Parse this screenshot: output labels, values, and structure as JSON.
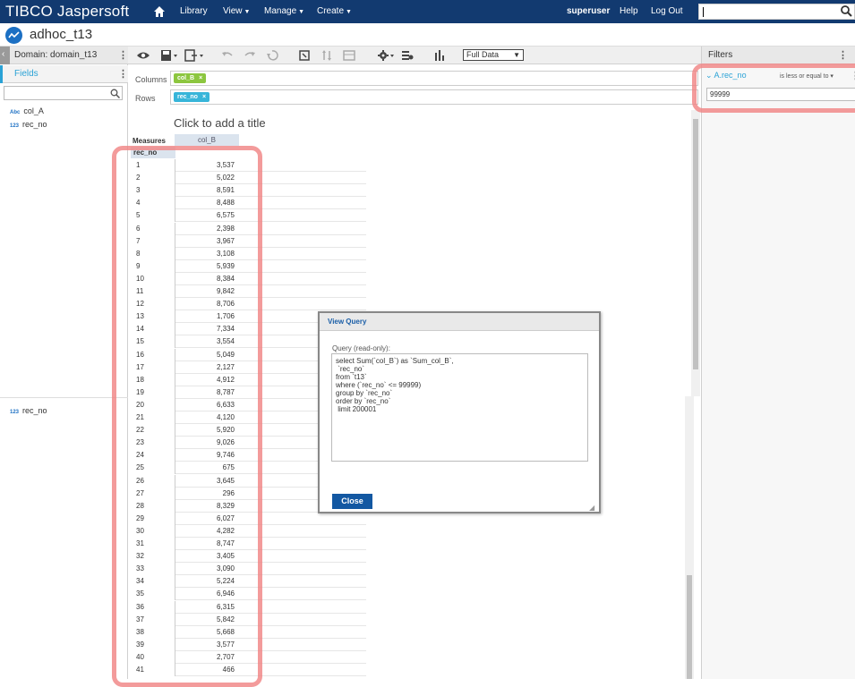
{
  "nav": {
    "logo": "TIBCO Jaspersoft",
    "library": "Library",
    "view": "View",
    "manage": "Manage",
    "create": "Create",
    "user": "superuser",
    "help": "Help",
    "logout": "Log Out"
  },
  "title": "adhoc_t13",
  "left_panel": {
    "domain_label": "Domain: domain_t13",
    "fields_tab": "Fields",
    "fields": [
      {
        "type": "Abc",
        "name": "col_A"
      },
      {
        "type": "123",
        "name": "rec_no"
      }
    ],
    "fields_lower": [
      {
        "type": "123",
        "name": "rec_no"
      }
    ]
  },
  "toolbar": {
    "data_size": "Full Data"
  },
  "axes": {
    "columns_label": "Columns",
    "rows_label": "Rows",
    "column_pill": "col_B",
    "row_pill": "rec_no"
  },
  "report": {
    "title_placeholder": "Click to add a title",
    "measures_label": "Measures",
    "measure_header": "col_B",
    "row_header": "rec_no",
    "rows": [
      [
        "1",
        "3,537"
      ],
      [
        "2",
        "5,022"
      ],
      [
        "3",
        "8,591"
      ],
      [
        "4",
        "8,488"
      ],
      [
        "5",
        "6,575"
      ],
      [
        "6",
        "2,398"
      ],
      [
        "7",
        "3,967"
      ],
      [
        "8",
        "3,108"
      ],
      [
        "9",
        "5,939"
      ],
      [
        "10",
        "8,384"
      ],
      [
        "11",
        "9,842"
      ],
      [
        "12",
        "8,706"
      ],
      [
        "13",
        "1,706"
      ],
      [
        "14",
        "7,334"
      ],
      [
        "15",
        "3,554"
      ],
      [
        "16",
        "5,049"
      ],
      [
        "17",
        "2,127"
      ],
      [
        "18",
        "4,912"
      ],
      [
        "19",
        "8,787"
      ],
      [
        "20",
        "6,633"
      ],
      [
        "21",
        "4,120"
      ],
      [
        "22",
        "5,920"
      ],
      [
        "23",
        "9,026"
      ],
      [
        "24",
        "9,746"
      ],
      [
        "25",
        "675"
      ],
      [
        "26",
        "3,645"
      ],
      [
        "27",
        "296"
      ],
      [
        "28",
        "8,329"
      ],
      [
        "29",
        "6,027"
      ],
      [
        "30",
        "4,282"
      ],
      [
        "31",
        "8,747"
      ],
      [
        "32",
        "3,405"
      ],
      [
        "33",
        "3,090"
      ],
      [
        "34",
        "5,224"
      ],
      [
        "35",
        "6,946"
      ],
      [
        "36",
        "6,315"
      ],
      [
        "37",
        "5,842"
      ],
      [
        "38",
        "5,668"
      ],
      [
        "39",
        "3,577"
      ],
      [
        "40",
        "2,707"
      ],
      [
        "41",
        "466"
      ]
    ]
  },
  "filters": {
    "header": "Filters",
    "field": "A.rec_no",
    "operator": "is less or equal to",
    "value": "99999"
  },
  "dialog": {
    "title": "View Query",
    "query_label": "Query (read-only):",
    "query": "select Sum(`col_B`) as `Sum_col_B`,\n `rec_no`\nfrom `t13`\nwhere (`rec_no` <= 99999)\ngroup by `rec_no`\norder by `rec_no`\n limit 200001",
    "close_label": "Close"
  }
}
